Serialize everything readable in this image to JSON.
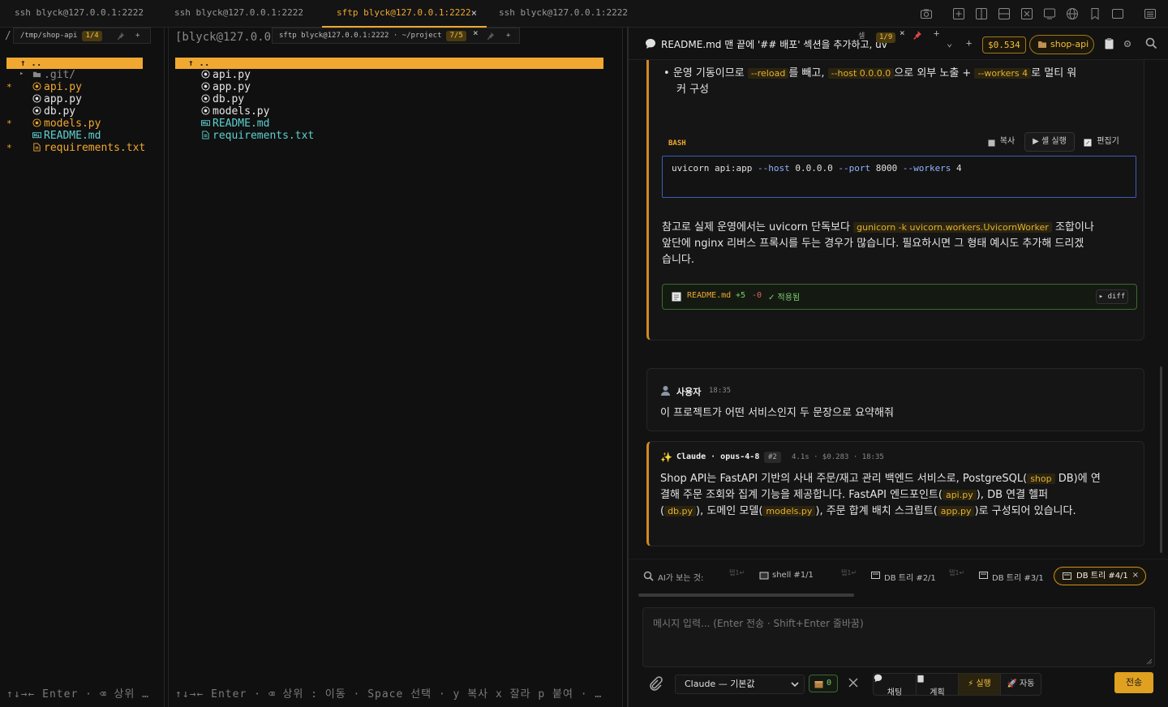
{
  "tabs": [
    {
      "label": "ssh blyck@127.0.0.1:2222",
      "active": false
    },
    {
      "label": "ssh blyck@127.0.0.1:2222",
      "active": false
    },
    {
      "label": "sftp blyck@127.0.0.1:2222",
      "active": true,
      "close": "×"
    },
    {
      "label": "ssh blyck@127.0.0.1:2222",
      "active": false
    }
  ],
  "left_pane": {
    "prefix": "/",
    "path_tab": "/tmp/shop-api",
    "path_count": "1/4",
    "add": "+",
    "up_row": "↑    ..",
    "files": [
      {
        "name": ".git/",
        "kind": "dir",
        "marker": "",
        "arrow": "▸"
      },
      {
        "name": "api.py",
        "kind": "py",
        "marker": "*"
      },
      {
        "name": "app.py",
        "kind": "py",
        "marker": ""
      },
      {
        "name": "db.py",
        "kind": "py",
        "marker": ""
      },
      {
        "name": "models.py",
        "kind": "py",
        "marker": "*"
      },
      {
        "name": "README.md",
        "kind": "md",
        "marker": ""
      },
      {
        "name": "requirements.txt",
        "kind": "txt",
        "marker": "*"
      }
    ],
    "footer": "↑↓→← Enter · ⌫ 상위 …"
  },
  "mid_pane": {
    "prompt": "[blyck@127.0.0.",
    "sub_tab": "sftp blyck@127.0.0.1:2222 · ~/project",
    "sub_count": "7/5",
    "close": "×",
    "add": "+",
    "up_row": "↑    ..",
    "files": [
      {
        "name": "api.py",
        "kind": "py"
      },
      {
        "name": "app.py",
        "kind": "py"
      },
      {
        "name": "db.py",
        "kind": "py"
      },
      {
        "name": "models.py",
        "kind": "py"
      },
      {
        "name": "README.md",
        "kind": "md"
      },
      {
        "name": "requirements.txt",
        "kind": "txt"
      }
    ],
    "footer": "↑↓→← Enter · ⌫ 상위 : 이동 · Space 선택 · y 복사 x 잘라 p 붙여 · …"
  },
  "chat": {
    "header_title": "README.md 맨 끝에 '## 배포' 섹션을 추가하고, uvicorn",
    "cell_label": "셀",
    "cell_count": "1/9",
    "close": "×",
    "add": "+",
    "chevron": "⌄",
    "cost": "$0.534",
    "project": "shop-api",
    "bullet_parts": [
      {
        "t": "운영 기동이므로 ",
        "code": false
      },
      {
        "t": "--reload",
        "code": true
      },
      {
        "t": "를 빼고, ",
        "code": false
      },
      {
        "t": "--host 0.0.0.0",
        "code": true
      },
      {
        "t": "으로 외부 노출 + ",
        "code": false
      },
      {
        "t": "--workers 4",
        "code": true
      },
      {
        "t": "로 멀티 워",
        "code": false
      }
    ],
    "bullet_cont": "커 구성",
    "code_block": {
      "lang": "BASH",
      "copy": "복사",
      "run": "▶ 셸 실행",
      "edit": "편집기",
      "cmd_parts": [
        {
          "t": "uvicorn api:app ",
          "c": "#e0e0e0"
        },
        {
          "t": "--host",
          "c": "#8fb4ff"
        },
        {
          "t": " 0.0.0.0 ",
          "c": "#e0e0e0"
        },
        {
          "t": "--port",
          "c": "#8fb4ff"
        },
        {
          "t": " 8000 ",
          "c": "#e0e0e0"
        },
        {
          "t": "--workers",
          "c": "#8fb4ff"
        },
        {
          "t": " 4",
          "c": "#e0e0e0"
        }
      ]
    },
    "note_line1_a": "참고로 실제 운영에서는 uvicorn 단독보다 ",
    "note_code": "gunicorn -k uvicorn.workers.UvicornWorker",
    "note_line1_b": " 조합이나",
    "note_line2": "앞단에 nginx 리버스 프록시를 두는 경우가 많습니다. 필요하시면 그 형태 예시도 추가해 드리겠",
    "note_line3": "습니다.",
    "diff_card": {
      "file": "README.md",
      "plus": "+5",
      "minus": "-0",
      "status": "✓ 적용됨",
      "btn": "▸ diff"
    },
    "user_msg": {
      "who": "사용자",
      "time": "18:35",
      "text": "이 프로젝트가 어떤 서비스인지 두 문장으로 요약해줘"
    },
    "ai_msg": {
      "who": "Claude · opus-4-8",
      "tag": "#2",
      "meta": "4.1s · $0.283 · 18:35",
      "line1_parts": [
        {
          "t": "Shop API는 FastAPI 기반의 사내 주문/재고 관리 백엔드 서비스로, PostgreSQL(",
          "code": false
        },
        {
          "t": "shop",
          "code": true
        },
        {
          "t": " DB)에 연",
          "code": false
        }
      ],
      "line2": "결해 주문 조회와 집계 기능을 제공합니다. FastAPI 엔드포인트(",
      "line2_code": "api.py",
      "line2_end": "), DB 연결 헬퍼",
      "line3_parts": [
        {
          "t": "(",
          "code": false
        },
        {
          "t": "db.py",
          "code": true
        },
        {
          "t": "), 도메인 모델(",
          "code": false
        },
        {
          "t": "models.py",
          "code": true
        },
        {
          "t": "), 주문 합계 배치 스크립트(",
          "code": false
        },
        {
          "t": "app.py",
          "code": true
        },
        {
          "t": ")로 구성되어 있습니다.",
          "code": false
        }
      ]
    },
    "context": {
      "label": "AI가 보는 것:",
      "items": [
        {
          "hint": "탭1↵",
          "label": "shell #1/1",
          "active": false
        },
        {
          "hint": "탭1↵",
          "label": "DB 트리 #2/1",
          "active": false
        },
        {
          "hint": "탭1↵",
          "label": "DB 트리 #3/1",
          "active": false
        },
        {
          "hint": "",
          "label": "DB 트리 #4/1",
          "active": true
        }
      ],
      "close": "×"
    },
    "input_placeholder": "메시지 입력... (Enter 전송 · Shift+Enter 줄바꿈)",
    "model_select": "Claude — 기본값",
    "badge_count": "0",
    "modes": [
      "채팅",
      "계획",
      "실행",
      "자동"
    ],
    "active_mode": "실행",
    "send": "전송"
  },
  "colors": {
    "accent": "#f0a830",
    "bg": "#0e0e0e",
    "teal": "#5fd0d0",
    "green": "#7fcf6f",
    "red": "#e06060"
  }
}
